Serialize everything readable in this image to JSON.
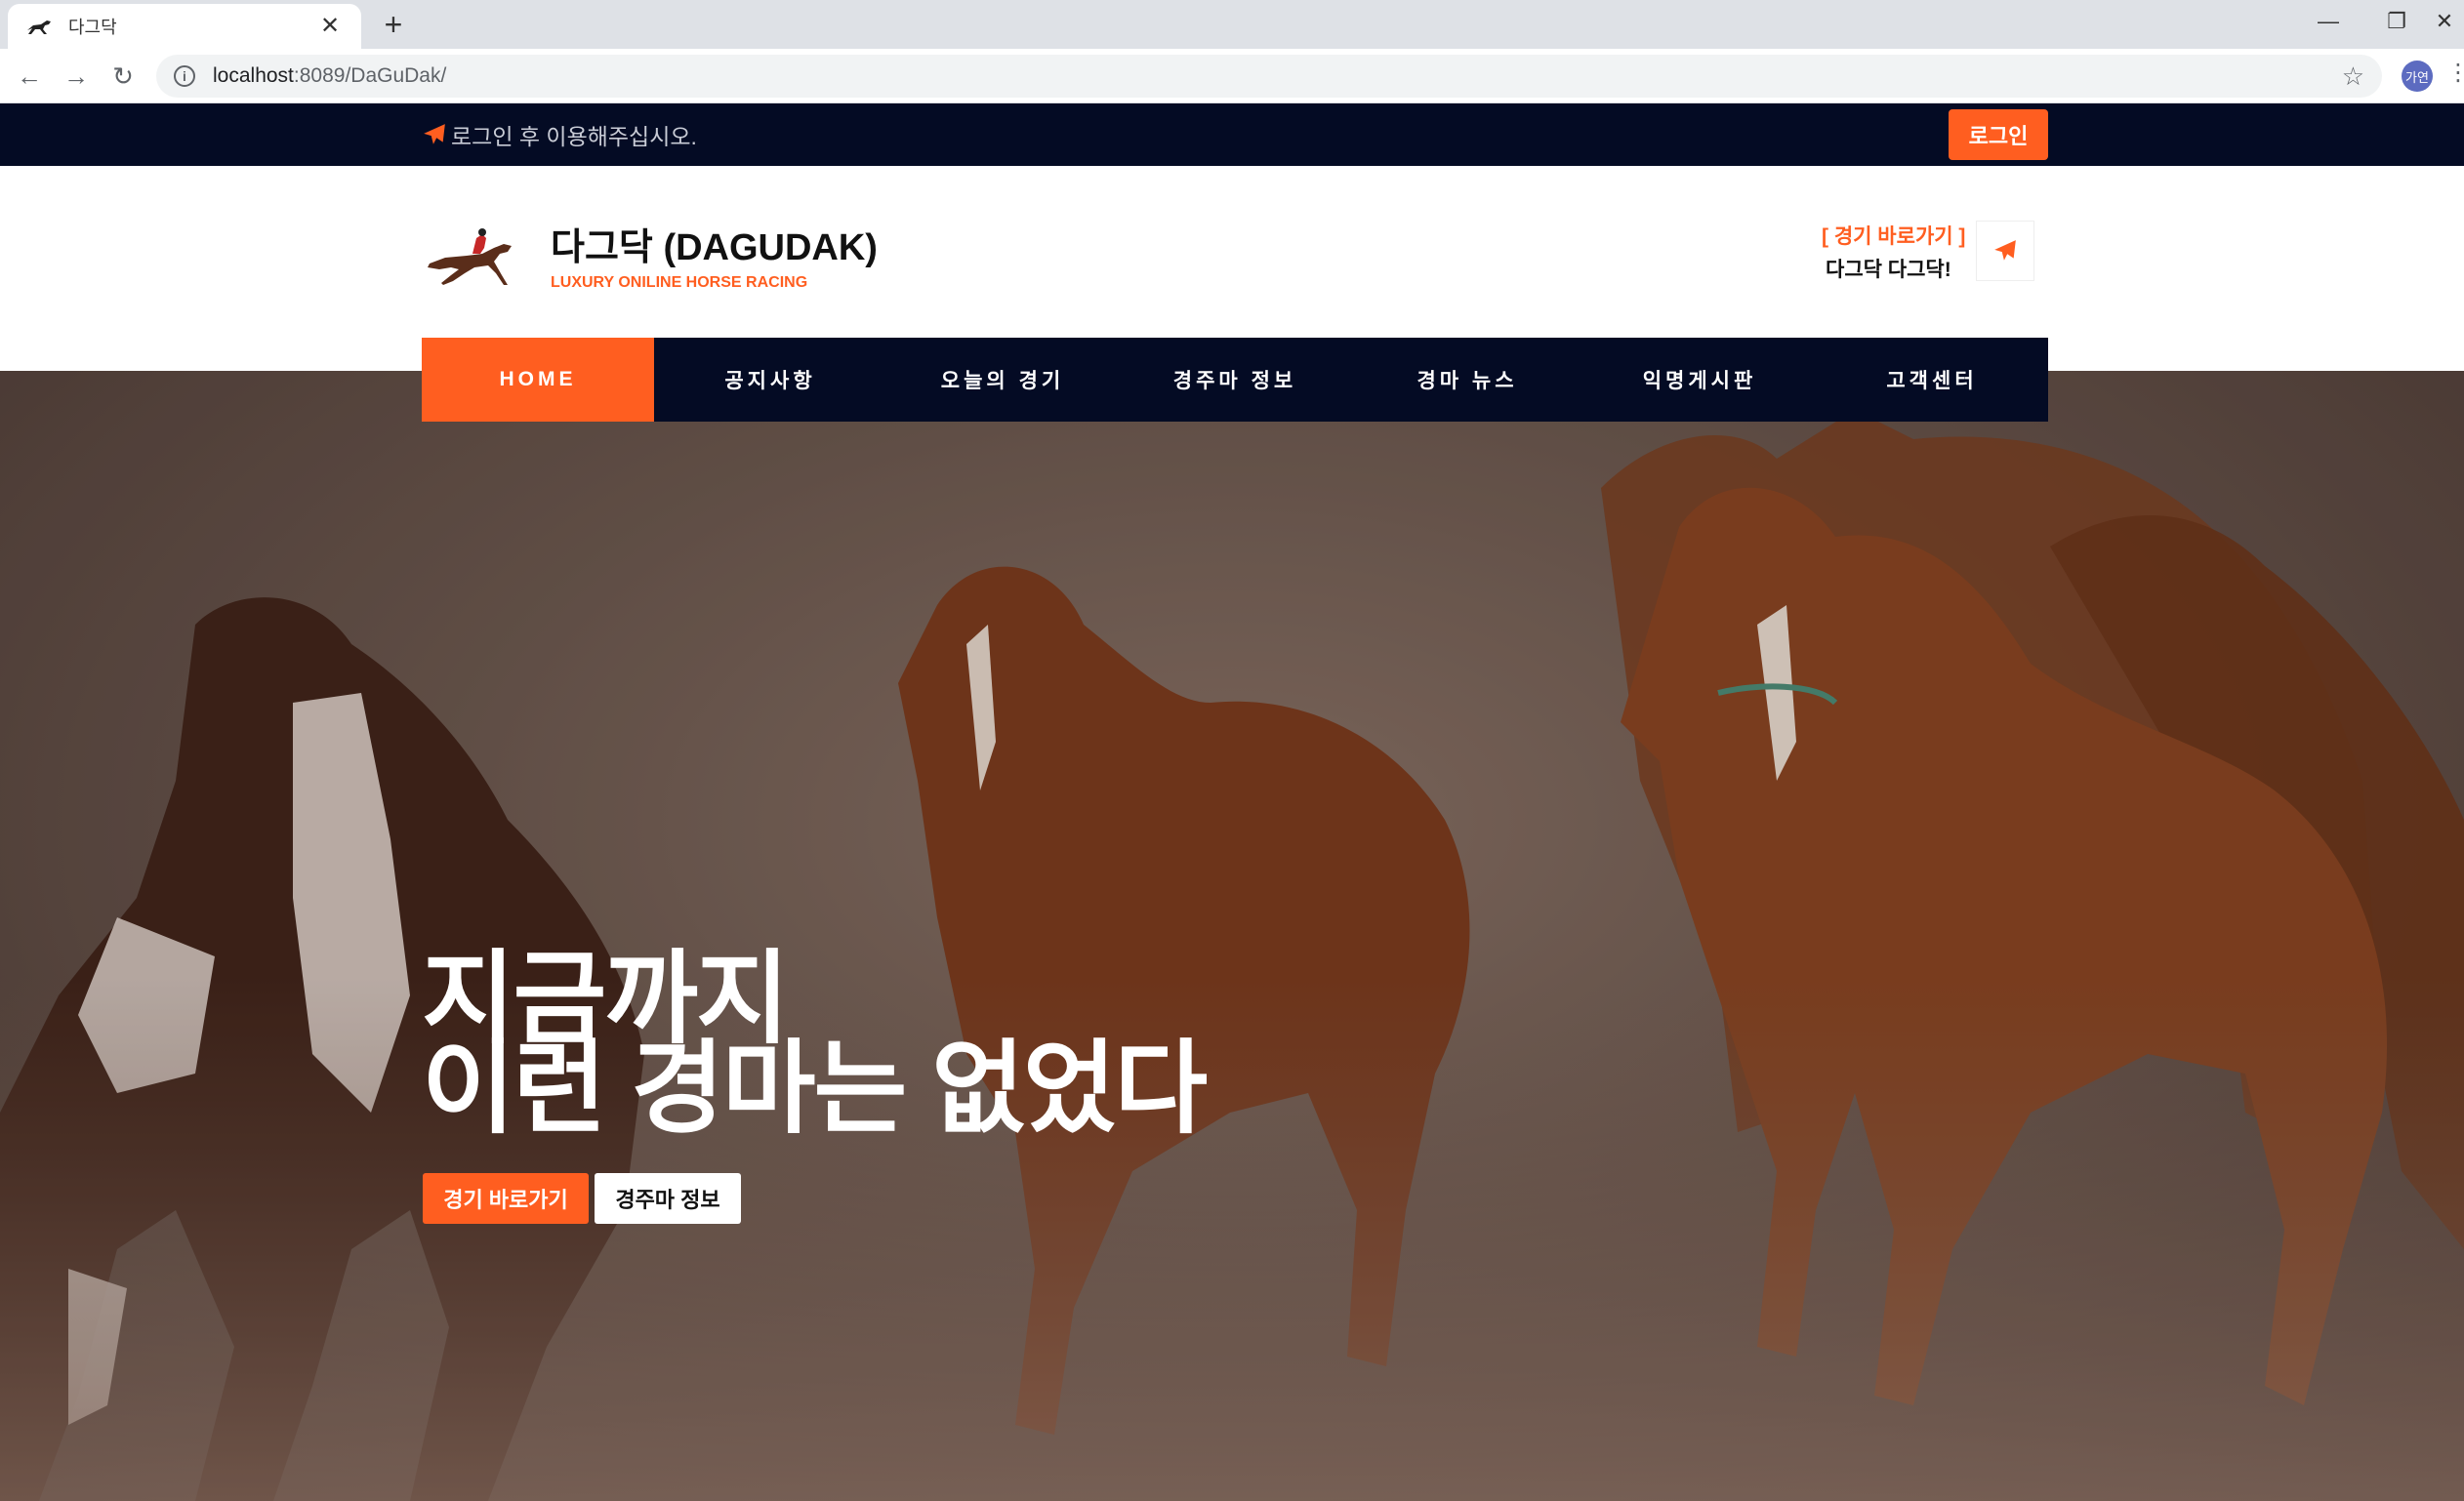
{
  "browser": {
    "tab_title": "다그닥",
    "tab_close": "✕",
    "new_tab": "+",
    "url_host": "localhost",
    "url_path": ":8089/DaGuDak/",
    "profile_label": "가연"
  },
  "site": {
    "topbar_message": "로그인 후 이용해주십시오.",
    "login_label": "로그인",
    "brand_title": "다그닥 (DAGUDAK)",
    "brand_subtitle": "LUXURY ONILINE HORSE RACING",
    "quick_label": "[ 경기 바로가기 ]",
    "quick_text": "다그닥 다그닥!",
    "nav": [
      {
        "label": "HOME",
        "active": true
      },
      {
        "label": "공지사항"
      },
      {
        "label": "오늘의 경기"
      },
      {
        "label": "경주마 정보"
      },
      {
        "label": "경마 뉴스"
      },
      {
        "label": "익명게시판"
      },
      {
        "label": "고객센터"
      }
    ],
    "hero_line1": "지금까지",
    "hero_line2": "이런 경마는 없었다",
    "hero_btn_primary": "경기 바로가기",
    "hero_btn_secondary": "경주마 정보"
  },
  "colors": {
    "accent": "#ff5e20",
    "navy": "#040b24"
  },
  "icons": [
    "horse-favicon-icon",
    "back-icon",
    "forward-icon",
    "reload-icon",
    "info-icon",
    "star-icon",
    "paper-plane-icon",
    "horse-jockey-logo-icon"
  ]
}
